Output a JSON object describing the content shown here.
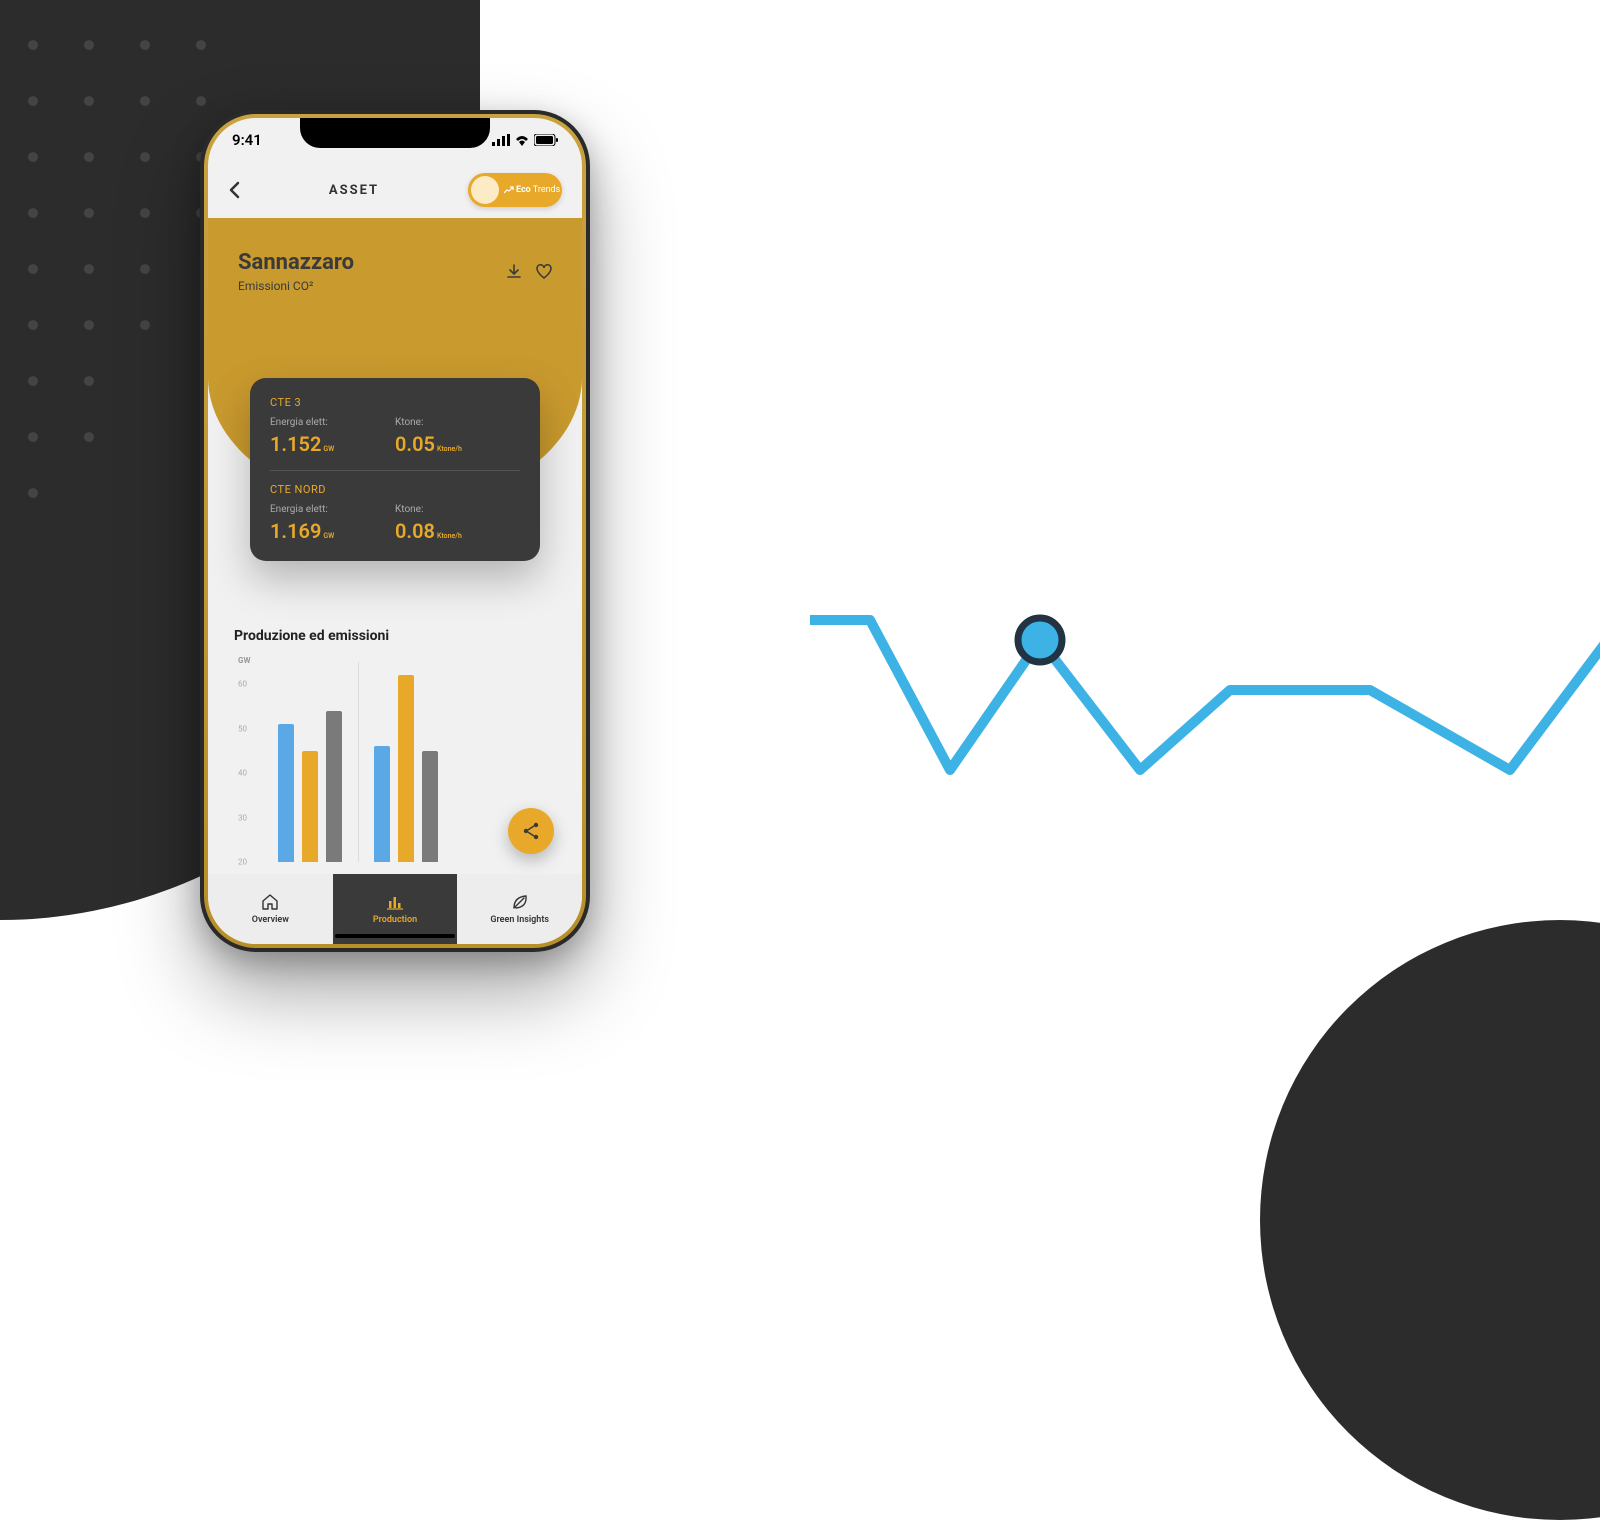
{
  "status": {
    "time": "9:41"
  },
  "nav": {
    "title": "ASSET",
    "toggle_label": "Eco Trends",
    "toggle_bold": "Eco"
  },
  "hero": {
    "title": "Sannazzaro",
    "subtitle": "Emissioni CO²"
  },
  "card": {
    "sections": [
      {
        "name": "CTE 3",
        "energy_label": "Energia elett:",
        "energy_value": "1.152",
        "energy_unit": "GW",
        "ktone_label": "Ktone:",
        "ktone_value": "0.05",
        "ktone_unit": "Ktone/h"
      },
      {
        "name": "CTE NORD",
        "energy_label": "Energia elett:",
        "energy_value": "1.169",
        "energy_unit": "GW",
        "ktone_label": "Ktone:",
        "ktone_value": "0.08",
        "ktone_unit": "Ktone/h"
      }
    ]
  },
  "chart": {
    "title": "Produzione ed emissioni",
    "ylabel": "GW"
  },
  "chart_data": {
    "type": "bar",
    "ylabel": "GW",
    "ylim": [
      20,
      65
    ],
    "ticks": [
      20,
      30,
      40,
      50,
      60
    ],
    "series_colors": [
      "#5aa9e6",
      "#e8a92a",
      "#7a7a7a"
    ],
    "groups": [
      {
        "values": [
          51,
          45,
          54
        ]
      },
      {
        "values": [
          46,
          62,
          45
        ]
      }
    ]
  },
  "tabs": {
    "overview": "Overview",
    "production": "Production",
    "green": "Green Insights"
  }
}
